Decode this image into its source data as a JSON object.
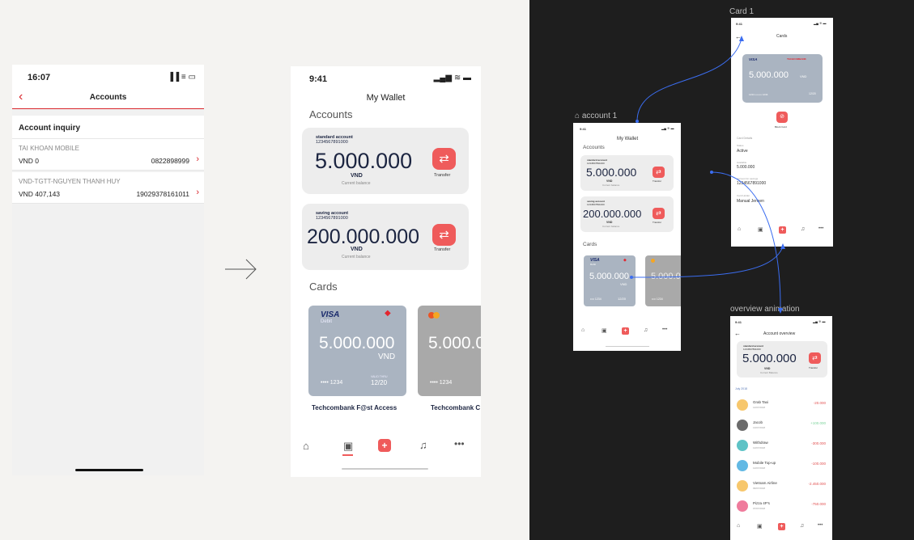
{
  "old_screen": {
    "time": "16:07",
    "status_icons": "▐▐ ≡ ▭",
    "back_icon": "‹",
    "title": "Accounts",
    "section": "Account inquiry",
    "accounts": [
      {
        "name": "TAI KHOAN MOBILE",
        "balance": "VND 0",
        "number": "0822898999"
      },
      {
        "name": "VND-TGTT-NGUYEN THANH HUY",
        "balance": "VND 407,143",
        "number": "19029378161011"
      }
    ]
  },
  "wallet": {
    "time": "9:41",
    "title": "My Wallet",
    "accounts_heading": "Accounts",
    "accounts": [
      {
        "type": "standard account",
        "number": "1234567891000",
        "amount": "5.000.000",
        "currency": "VND",
        "caption": "Current balance",
        "action": "Transfer"
      },
      {
        "type": "saving account",
        "number": "1234567891000",
        "amount": "200.000.000",
        "currency": "VND",
        "caption": "Current balance",
        "action": "Transfer"
      }
    ],
    "cards_heading": "Cards",
    "cards": [
      {
        "brand": "VISA",
        "sub": "Debit",
        "amount": "5.000.000",
        "currency": "VND",
        "masked": "•••• 1234",
        "valid_label": "VALID THRU",
        "expiry": "12/20",
        "name": "Techcombank F@st Access",
        "color": "#aab4c1"
      },
      {
        "brand": "",
        "sub": "",
        "amount": "5.000.0",
        "currency": "",
        "masked": "•••• 1234",
        "valid_label": "",
        "expiry": "",
        "name": "Techcombank C",
        "color": "#a9a9a9"
      }
    ],
    "tabs": [
      "home-icon",
      "wallet-icon",
      "plus-icon",
      "bell-icon",
      "more-icon"
    ]
  },
  "canvas": {
    "frame_account": "account 1",
    "frame_card": "Card 1",
    "frame_overview": "overview animation",
    "account_screen": {
      "time": "9:41",
      "title": "My Wallet",
      "accounts_heading": "Accounts",
      "acc1_type": "standard account",
      "acc1_no": "1234567891000",
      "acc1_amount": "5.000.000",
      "acc2_type": "saving account",
      "acc2_no": "1234567891000",
      "acc2_amount": "200.000.000",
      "currency": "VND",
      "caption": "Current balance",
      "transfer": "Transfer",
      "cards_heading": "Cards",
      "card_brand": "VISA",
      "card_sub": "Debit",
      "card_amount": "5.000.000",
      "card2_amount": "5.000.0",
      "card_masked": "•••• 1234",
      "card_exp": "12/20"
    },
    "card_screen": {
      "time": "9:41",
      "title": "Cards",
      "brand": "VISA",
      "bank": "TECHCOMBANK",
      "amount": "5.000.000",
      "currency": "VND",
      "masked": "1234 •••••••• 1234",
      "expiry": "12/20",
      "block": "Block Card",
      "details_heading": "Card Details",
      "status_label": "Status",
      "status": "Active",
      "available_label": "Available",
      "available": "5.000.000",
      "linked_label": "Account for savings",
      "linked": "1234567891000",
      "holder_label": "Card Holder",
      "holder": "Manual Jensen"
    },
    "overview_screen": {
      "time": "9:41",
      "title": "Account overview",
      "acc_type": "standard account",
      "acc_no": "1234567891000",
      "amount": "5.000.000",
      "currency": "VND",
      "caption": "Current Balance",
      "transfer": "Transfer",
      "month": "July 2018",
      "transactions": [
        {
          "name": "Grab Taxi",
          "date": "14/07/2018",
          "amount": "-20.000",
          "color": "#f7c76c",
          "amount_color": "#e25252"
        },
        {
          "name": "Jacob",
          "date": "13/07/2018",
          "amount": "+100.000",
          "color": "#6b6b6b",
          "amount_color": "#7bd39a"
        },
        {
          "name": "Withdraw",
          "date": "12/07/2018",
          "amount": "-300.000",
          "color": "#5ec3c6",
          "amount_color": "#e25252"
        },
        {
          "name": "Mobile Top-up",
          "date": "12/07/2018",
          "amount": "-100.000",
          "color": "#62b9e4",
          "amount_color": "#e25252"
        },
        {
          "name": "Vietnam Airline",
          "date": "09/07/2018",
          "amount": "-2.450.000",
          "color": "#f7c76c",
          "amount_color": "#e25252"
        },
        {
          "name": "Pizza 4P's",
          "date": "07/07/2018",
          "amount": "-750.000",
          "color": "#ef7b9c",
          "amount_color": "#e25252"
        }
      ]
    }
  }
}
